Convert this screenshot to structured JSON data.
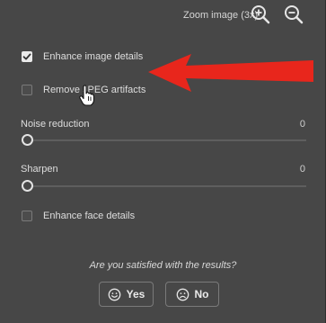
{
  "zoom": {
    "label": "Zoom image (3x)",
    "zoom_in_icon": "zoom-in-icon",
    "zoom_out_icon": "zoom-out-icon"
  },
  "options": [
    {
      "label": "Enhance image details",
      "checked": true
    },
    {
      "label": "Remove JPEG artifacts",
      "checked": false
    }
  ],
  "sliders": [
    {
      "label": "Noise reduction",
      "value": "0"
    },
    {
      "label": "Sharpen",
      "value": "0"
    }
  ],
  "face_option": {
    "label": "Enhance face details",
    "checked": false
  },
  "feedback": {
    "question": "Are you satisfied with the results?",
    "yes_label": "Yes",
    "no_label": "No",
    "yes_icon": "smile-icon",
    "no_icon": "frown-icon"
  },
  "colors": {
    "background": "#474747",
    "annotation_arrow": "#e8261c"
  }
}
